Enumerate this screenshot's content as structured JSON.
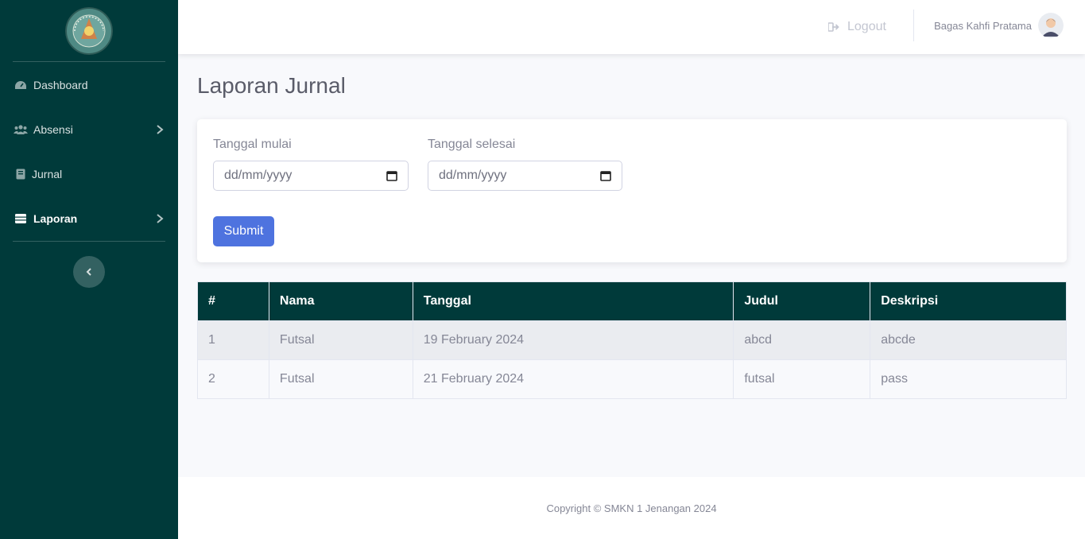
{
  "sidebar": {
    "logo_text": "SMK NEGERI 1 JENANGAN PONOROGO",
    "items": [
      {
        "label": "Dashboard",
        "icon": "tachometer-icon"
      },
      {
        "label": "Absensi",
        "icon": "users-icon"
      },
      {
        "label": "Jurnal",
        "icon": "book-icon"
      },
      {
        "label": "Laporan",
        "icon": "table-icon"
      }
    ]
  },
  "topbar": {
    "logout_label": "Logout",
    "user_name": "Bagas Kahfi Pratama"
  },
  "page": {
    "title": "Laporan Jurnal"
  },
  "form": {
    "start_label": "Tanggal mulai",
    "start_placeholder": "dd/mm/yyyy",
    "end_label": "Tanggal selesai",
    "end_placeholder": "dd/mm/yyyy",
    "submit_label": "Submit"
  },
  "table": {
    "headers": [
      "#",
      "Nama",
      "Tanggal",
      "Judul",
      "Deskripsi"
    ],
    "rows": [
      [
        "1",
        "Futsal",
        "19 February 2024",
        "abcd",
        "abcde"
      ],
      [
        "2",
        "Futsal",
        "21 February 2024",
        "futsal",
        "pass"
      ]
    ]
  },
  "footer": {
    "copyright": "Copyright © SMKN 1 Jenangan 2024"
  },
  "colors": {
    "sidebar": "#003a3a",
    "primary": "#4e73df",
    "table_header": "#003a3a"
  }
}
